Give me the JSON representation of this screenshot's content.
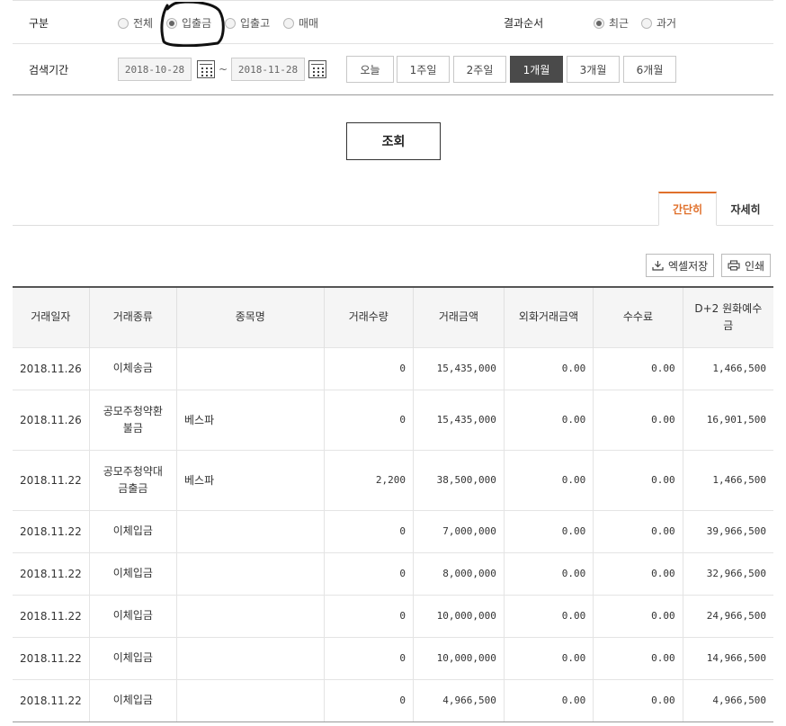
{
  "filter": {
    "category_label": "구분",
    "category_options": [
      {
        "label": "전체",
        "checked": false
      },
      {
        "label": "입출금",
        "checked": true
      },
      {
        "label": "입출고",
        "checked": false
      },
      {
        "label": "매매",
        "checked": false
      }
    ],
    "order_label": "결과순서",
    "order_options": [
      {
        "label": "최근",
        "checked": true
      },
      {
        "label": "과거",
        "checked": false
      }
    ],
    "period_label": "검색기간",
    "date_from": "2018-10-28",
    "date_to": "2018-11-28",
    "tilde": "~",
    "period_buttons": [
      {
        "label": "오늘",
        "active": false
      },
      {
        "label": "1주일",
        "active": false
      },
      {
        "label": "2주일",
        "active": false
      },
      {
        "label": "1개월",
        "active": true
      },
      {
        "label": "3개월",
        "active": false
      },
      {
        "label": "6개월",
        "active": false
      }
    ]
  },
  "search_button": "조회",
  "tabs": [
    {
      "label": "간단히",
      "active": true
    },
    {
      "label": "자세히",
      "active": false
    }
  ],
  "tools": {
    "excel_label": "엑셀저장",
    "print_label": "인쇄",
    "excel_icon": "download-icon",
    "print_icon": "printer-icon"
  },
  "table": {
    "headers": [
      "거래일자",
      "거래종류",
      "종목명",
      "거래수량",
      "거래금액",
      "외화거래금액",
      "수수료",
      "D+2 원화예수금"
    ],
    "rows": [
      {
        "date": "2018.11.26",
        "type": "이체송금",
        "name": "",
        "qty": "0",
        "amount": "15,435,000",
        "fx": "0.00",
        "fee": "0.00",
        "deposit": "1,466,500"
      },
      {
        "date": "2018.11.26",
        "type": "공모주청약환불금",
        "name": "베스파",
        "qty": "0",
        "amount": "15,435,000",
        "fx": "0.00",
        "fee": "0.00",
        "deposit": "16,901,500"
      },
      {
        "date": "2018.11.22",
        "type": "공모주청약대금출금",
        "name": "베스파",
        "qty": "2,200",
        "amount": "38,500,000",
        "fx": "0.00",
        "fee": "0.00",
        "deposit": "1,466,500"
      },
      {
        "date": "2018.11.22",
        "type": "이체입금",
        "name": "",
        "qty": "0",
        "amount": "7,000,000",
        "fx": "0.00",
        "fee": "0.00",
        "deposit": "39,966,500"
      },
      {
        "date": "2018.11.22",
        "type": "이체입금",
        "name": "",
        "qty": "0",
        "amount": "8,000,000",
        "fx": "0.00",
        "fee": "0.00",
        "deposit": "32,966,500"
      },
      {
        "date": "2018.11.22",
        "type": "이체입금",
        "name": "",
        "qty": "0",
        "amount": "10,000,000",
        "fx": "0.00",
        "fee": "0.00",
        "deposit": "24,966,500"
      },
      {
        "date": "2018.11.22",
        "type": "이체입금",
        "name": "",
        "qty": "0",
        "amount": "10,000,000",
        "fx": "0.00",
        "fee": "0.00",
        "deposit": "14,966,500"
      },
      {
        "date": "2018.11.22",
        "type": "이체입금",
        "name": "",
        "qty": "0",
        "amount": "4,966,500",
        "fx": "0.00",
        "fee": "0.00",
        "deposit": "4,966,500"
      }
    ]
  },
  "colors": {
    "accent": "#e0702b",
    "link": "#1a5d92",
    "active_button": "#4a4a4a"
  }
}
